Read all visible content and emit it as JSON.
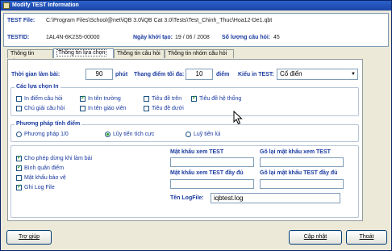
{
  "window": {
    "title": "Modify TEST Information"
  },
  "header": {
    "test_file_label": "TEST File:",
    "test_file_value": "C:\\Program Files\\School@net\\iQB 3.0\\iQB Cat 3.0\\Tests\\Test_Chinh_Thuc\\Hoa12-De1.qbt",
    "testid_label": "TESTID:",
    "testid_value": "1AL4N-6K2S5-00000",
    "created_label": "Ngày khởi tạo:",
    "created_value": "19 / 06 / 2008",
    "qcount_label": "Số lượng câu hỏi:",
    "qcount_value": "45"
  },
  "tabs": [
    {
      "label": "Thông tin chung"
    },
    {
      "label": "Thông tin lựa chọn"
    },
    {
      "label": "Thông tin câu hỏi"
    },
    {
      "label": "Thông tin nhóm câu hỏi"
    }
  ],
  "options": {
    "time_label": "Thời gian làm bài:",
    "time_value": "90",
    "time_unit": "phút",
    "max_score_label": "Thang điểm tối đa:",
    "max_score_value": "10",
    "max_score_unit": "điểm",
    "print_type_label": "Kiểu in TEST:",
    "print_type_value": "Cổ điển",
    "print_group_title": "Các lựa chọn In",
    "print_options": [
      {
        "label": "In điểm câu hỏi",
        "checked": false
      },
      {
        "label": "In tên trường",
        "checked": true
      },
      {
        "label": "Tiêu đề trên",
        "checked": false
      },
      {
        "label": "Tiêu đề hệ thống",
        "checked": true
      },
      {
        "label": "Chú giải câu hỏi",
        "checked": false
      },
      {
        "label": "In tên giáo viên",
        "checked": false
      },
      {
        "label": "Tiêu đề dưới",
        "checked": false
      }
    ],
    "method_group_title": "Phương pháp tính điểm",
    "methods": [
      {
        "label": "Phương pháp 1/0",
        "selected": false
      },
      {
        "label": "Lũy tiến tích cực",
        "selected": true
      },
      {
        "label": "Luỹ tiến lùi",
        "selected": false
      }
    ],
    "extra_options": [
      {
        "label": "Cho phép dừng khi làm bài",
        "checked": true
      },
      {
        "label": "Bình quân điểm",
        "checked": true
      },
      {
        "label": "Mật khẩu bảo vệ",
        "checked": false
      },
      {
        "label": "Ghi Log File",
        "checked": true
      }
    ],
    "pw_view_label": "Mật khẩu xem TEST",
    "pw_view_confirm_label": "Gõ lại mật khẩu xem TEST",
    "pw_full_label": "Mật khẩu xem TEST đầy đủ",
    "pw_full_confirm_label": "Gõ lại mật khẩu TEST đầy đủ",
    "logfile_label": "Tên LogFile:",
    "logfile_value": "iqbtest.log"
  },
  "buttons": {
    "help": "Trợ giúp",
    "update": "Cập nhật",
    "exit": "Thoát"
  },
  "colors": {
    "label_blue": "#1a3aa0",
    "check_green": "#21a121",
    "titlebar": "#1c46a8"
  }
}
